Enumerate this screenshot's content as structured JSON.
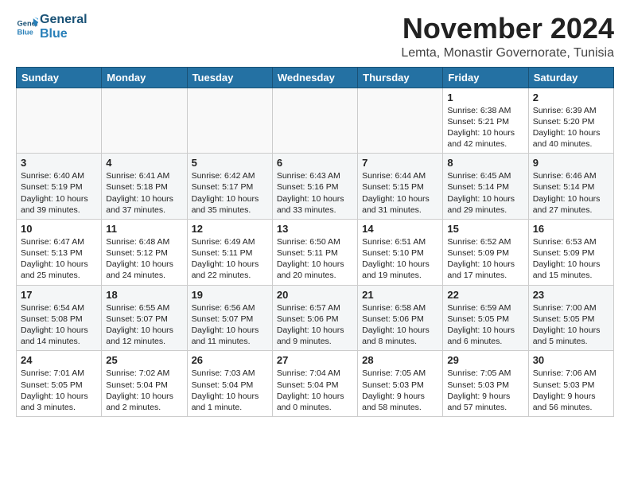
{
  "logo": {
    "line1": "General",
    "line2": "Blue"
  },
  "title": "November 2024",
  "location": "Lemta, Monastir Governorate, Tunisia",
  "headers": [
    "Sunday",
    "Monday",
    "Tuesday",
    "Wednesday",
    "Thursday",
    "Friday",
    "Saturday"
  ],
  "weeks": [
    [
      {
        "day": "",
        "info": ""
      },
      {
        "day": "",
        "info": ""
      },
      {
        "day": "",
        "info": ""
      },
      {
        "day": "",
        "info": ""
      },
      {
        "day": "",
        "info": ""
      },
      {
        "day": "1",
        "info": "Sunrise: 6:38 AM\nSunset: 5:21 PM\nDaylight: 10 hours and 42 minutes."
      },
      {
        "day": "2",
        "info": "Sunrise: 6:39 AM\nSunset: 5:20 PM\nDaylight: 10 hours and 40 minutes."
      }
    ],
    [
      {
        "day": "3",
        "info": "Sunrise: 6:40 AM\nSunset: 5:19 PM\nDaylight: 10 hours and 39 minutes."
      },
      {
        "day": "4",
        "info": "Sunrise: 6:41 AM\nSunset: 5:18 PM\nDaylight: 10 hours and 37 minutes."
      },
      {
        "day": "5",
        "info": "Sunrise: 6:42 AM\nSunset: 5:17 PM\nDaylight: 10 hours and 35 minutes."
      },
      {
        "day": "6",
        "info": "Sunrise: 6:43 AM\nSunset: 5:16 PM\nDaylight: 10 hours and 33 minutes."
      },
      {
        "day": "7",
        "info": "Sunrise: 6:44 AM\nSunset: 5:15 PM\nDaylight: 10 hours and 31 minutes."
      },
      {
        "day": "8",
        "info": "Sunrise: 6:45 AM\nSunset: 5:14 PM\nDaylight: 10 hours and 29 minutes."
      },
      {
        "day": "9",
        "info": "Sunrise: 6:46 AM\nSunset: 5:14 PM\nDaylight: 10 hours and 27 minutes."
      }
    ],
    [
      {
        "day": "10",
        "info": "Sunrise: 6:47 AM\nSunset: 5:13 PM\nDaylight: 10 hours and 25 minutes."
      },
      {
        "day": "11",
        "info": "Sunrise: 6:48 AM\nSunset: 5:12 PM\nDaylight: 10 hours and 24 minutes."
      },
      {
        "day": "12",
        "info": "Sunrise: 6:49 AM\nSunset: 5:11 PM\nDaylight: 10 hours and 22 minutes."
      },
      {
        "day": "13",
        "info": "Sunrise: 6:50 AM\nSunset: 5:11 PM\nDaylight: 10 hours and 20 minutes."
      },
      {
        "day": "14",
        "info": "Sunrise: 6:51 AM\nSunset: 5:10 PM\nDaylight: 10 hours and 19 minutes."
      },
      {
        "day": "15",
        "info": "Sunrise: 6:52 AM\nSunset: 5:09 PM\nDaylight: 10 hours and 17 minutes."
      },
      {
        "day": "16",
        "info": "Sunrise: 6:53 AM\nSunset: 5:09 PM\nDaylight: 10 hours and 15 minutes."
      }
    ],
    [
      {
        "day": "17",
        "info": "Sunrise: 6:54 AM\nSunset: 5:08 PM\nDaylight: 10 hours and 14 minutes."
      },
      {
        "day": "18",
        "info": "Sunrise: 6:55 AM\nSunset: 5:07 PM\nDaylight: 10 hours and 12 minutes."
      },
      {
        "day": "19",
        "info": "Sunrise: 6:56 AM\nSunset: 5:07 PM\nDaylight: 10 hours and 11 minutes."
      },
      {
        "day": "20",
        "info": "Sunrise: 6:57 AM\nSunset: 5:06 PM\nDaylight: 10 hours and 9 minutes."
      },
      {
        "day": "21",
        "info": "Sunrise: 6:58 AM\nSunset: 5:06 PM\nDaylight: 10 hours and 8 minutes."
      },
      {
        "day": "22",
        "info": "Sunrise: 6:59 AM\nSunset: 5:05 PM\nDaylight: 10 hours and 6 minutes."
      },
      {
        "day": "23",
        "info": "Sunrise: 7:00 AM\nSunset: 5:05 PM\nDaylight: 10 hours and 5 minutes."
      }
    ],
    [
      {
        "day": "24",
        "info": "Sunrise: 7:01 AM\nSunset: 5:05 PM\nDaylight: 10 hours and 3 minutes."
      },
      {
        "day": "25",
        "info": "Sunrise: 7:02 AM\nSunset: 5:04 PM\nDaylight: 10 hours and 2 minutes."
      },
      {
        "day": "26",
        "info": "Sunrise: 7:03 AM\nSunset: 5:04 PM\nDaylight: 10 hours and 1 minute."
      },
      {
        "day": "27",
        "info": "Sunrise: 7:04 AM\nSunset: 5:04 PM\nDaylight: 10 hours and 0 minutes."
      },
      {
        "day": "28",
        "info": "Sunrise: 7:05 AM\nSunset: 5:03 PM\nDaylight: 9 hours and 58 minutes."
      },
      {
        "day": "29",
        "info": "Sunrise: 7:05 AM\nSunset: 5:03 PM\nDaylight: 9 hours and 57 minutes."
      },
      {
        "day": "30",
        "info": "Sunrise: 7:06 AM\nSunset: 5:03 PM\nDaylight: 9 hours and 56 minutes."
      }
    ]
  ]
}
